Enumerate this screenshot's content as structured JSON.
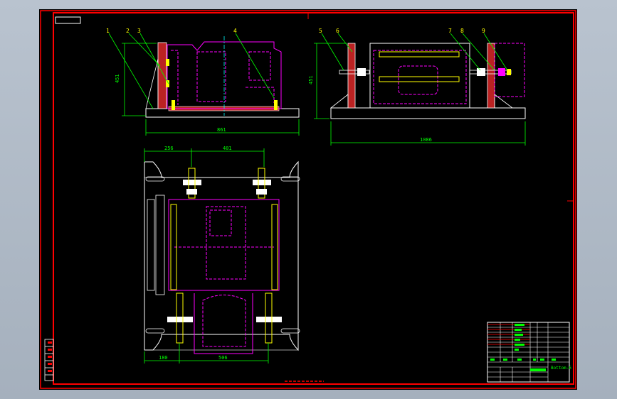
{
  "viewer": {
    "background": "#aab4c0"
  },
  "drawing": {
    "colors": {
      "frame": "#ff0000",
      "outline": "#ffffff",
      "hidden": "#ff00ff",
      "center": "#00ffff",
      "dim": "#00ff00",
      "leader": "#00ff00",
      "label": "#ffff00"
    },
    "front_view": {
      "part_labels": [
        "1",
        "2",
        "3",
        "4"
      ],
      "height_dim": "451",
      "width_dim": "861"
    },
    "side_view": {
      "part_labels": [
        "5",
        "6",
        "7",
        "8",
        "9"
      ],
      "height_dim": "451",
      "width_dim": "1086"
    },
    "top_view": {
      "left_dim": "256",
      "center_dim": "401",
      "bottom_left_dim": "180",
      "bottom_center_dim": "506"
    },
    "title_block": {
      "drawing_no": "Bottom-6"
    }
  }
}
